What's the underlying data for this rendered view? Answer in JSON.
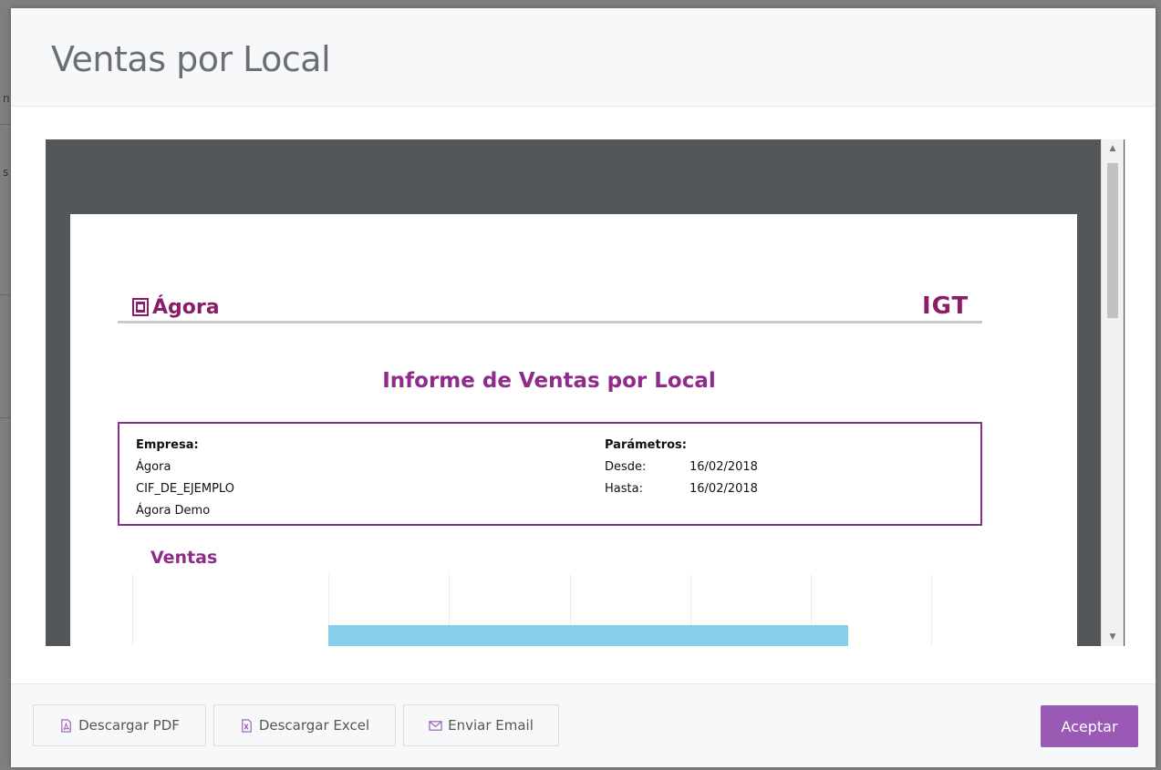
{
  "background": {
    "peek_glyph_1": "n",
    "peek_glyph_2": "s"
  },
  "modal": {
    "title": "Ventas por Local"
  },
  "viewer": {
    "scroll_up_icon": "▲",
    "scroll_down_icon": "▼"
  },
  "report": {
    "logo_left_text": "Ágora",
    "logo_right_text": "IGT",
    "title": "Informe de Ventas por Local",
    "empresa": {
      "label": "Empresa:",
      "name": "Ágora",
      "cif": "CIF_DE_EJEMPLO",
      "site": "Ágora Demo"
    },
    "parametros": {
      "label": "Parámetros:",
      "desde_label": "Desde:",
      "desde_value": "16/02/2018",
      "hasta_label": "Hasta:",
      "hasta_value": "16/02/2018"
    },
    "section_title": "Ventas"
  },
  "footer": {
    "pdf_label": "Descargar PDF",
    "excel_label": "Descargar Excel",
    "email_label": "Enviar Email",
    "accept_label": "Aceptar"
  },
  "colors": {
    "accent": "#9b59b6",
    "report_purple": "#8e2b8c",
    "logo_color": "#8b1d68",
    "chart_bar": "#87ceeb",
    "viewer_bg": "#535759"
  }
}
